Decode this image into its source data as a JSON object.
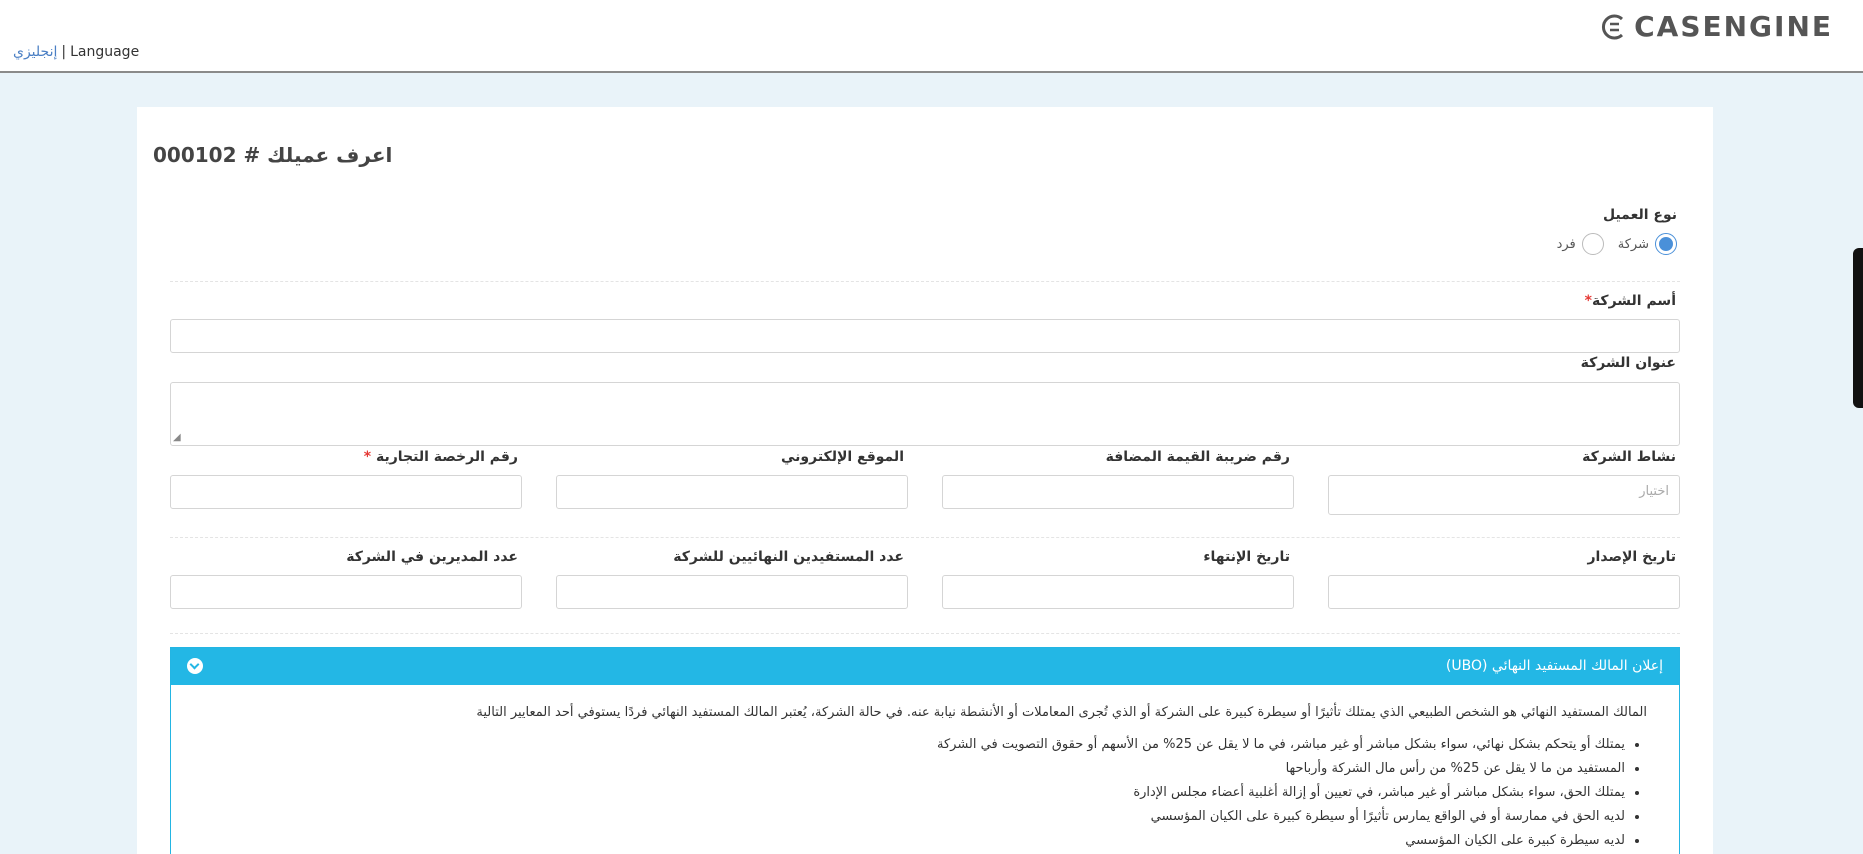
{
  "header": {
    "lang_arabic": "إنجليزي",
    "lang_sep": "|",
    "lang_label": "Language",
    "brand": "CASENGINE",
    "brand_icon": "casengine-logo-icon"
  },
  "page": {
    "title": "اعرف عميلك # 000102"
  },
  "client_type": {
    "label": "نوع العميل",
    "options": [
      "شركة",
      "فرد"
    ],
    "selected": "شركة"
  },
  "fields": {
    "company_name": "أسم الشركة",
    "company_address": "عنوان الشركة",
    "company_activity": "نشاط الشركة",
    "activity_placeholder": "اختيار",
    "vat_number": "رقم ضريبة القيمة المضافة",
    "website": "الموقع الإلكتروني",
    "license_number": "رقم الرخصة التجارية",
    "issue_date": "تاريخ الإصدار",
    "expiry_date": "تاريخ الإنتهاء",
    "ubo_count": "عدد المستفيدين النهائيين للشركة",
    "directors_count": "عدد المديرين في الشركة",
    "required_mark": "*"
  },
  "ubo_panel": {
    "title": "إعلان المالك المستفيد النهائي (UBO)",
    "intro": "المالك المستفيد النهائي هو الشخص الطبيعي الذي يمتلك تأثيرًا أو سيطرة كبيرة على الشركة أو الذي تُجرى المعاملات أو الأنشطة نيابة عنه. في حالة الشركة، يُعتبر المالك المستفيد النهائي فردًا يستوفي أحد المعايير التالية",
    "criteria": [
      "يمتلك أو يتحكم بشكل نهائي، سواء بشكل مباشر أو غير مباشر، في ما لا يقل عن 25% من الأسهم أو حقوق التصويت في الشركة",
      "المستفيد من ما لا يقل عن 25% من رأس مال الشركة وأرباحها",
      "يمتلك الحق، سواء بشكل مباشر أو غير مباشر، في تعيين أو إزالة أغلبية أعضاء مجلس الإدارة",
      "لديه الحق في ممارسة أو في الواقع يمارس تأثيرًا أو سيطرة كبيرة على الكيان المؤسسي",
      "لديه سيطرة كبيرة على الكيان المؤسسي"
    ]
  }
}
